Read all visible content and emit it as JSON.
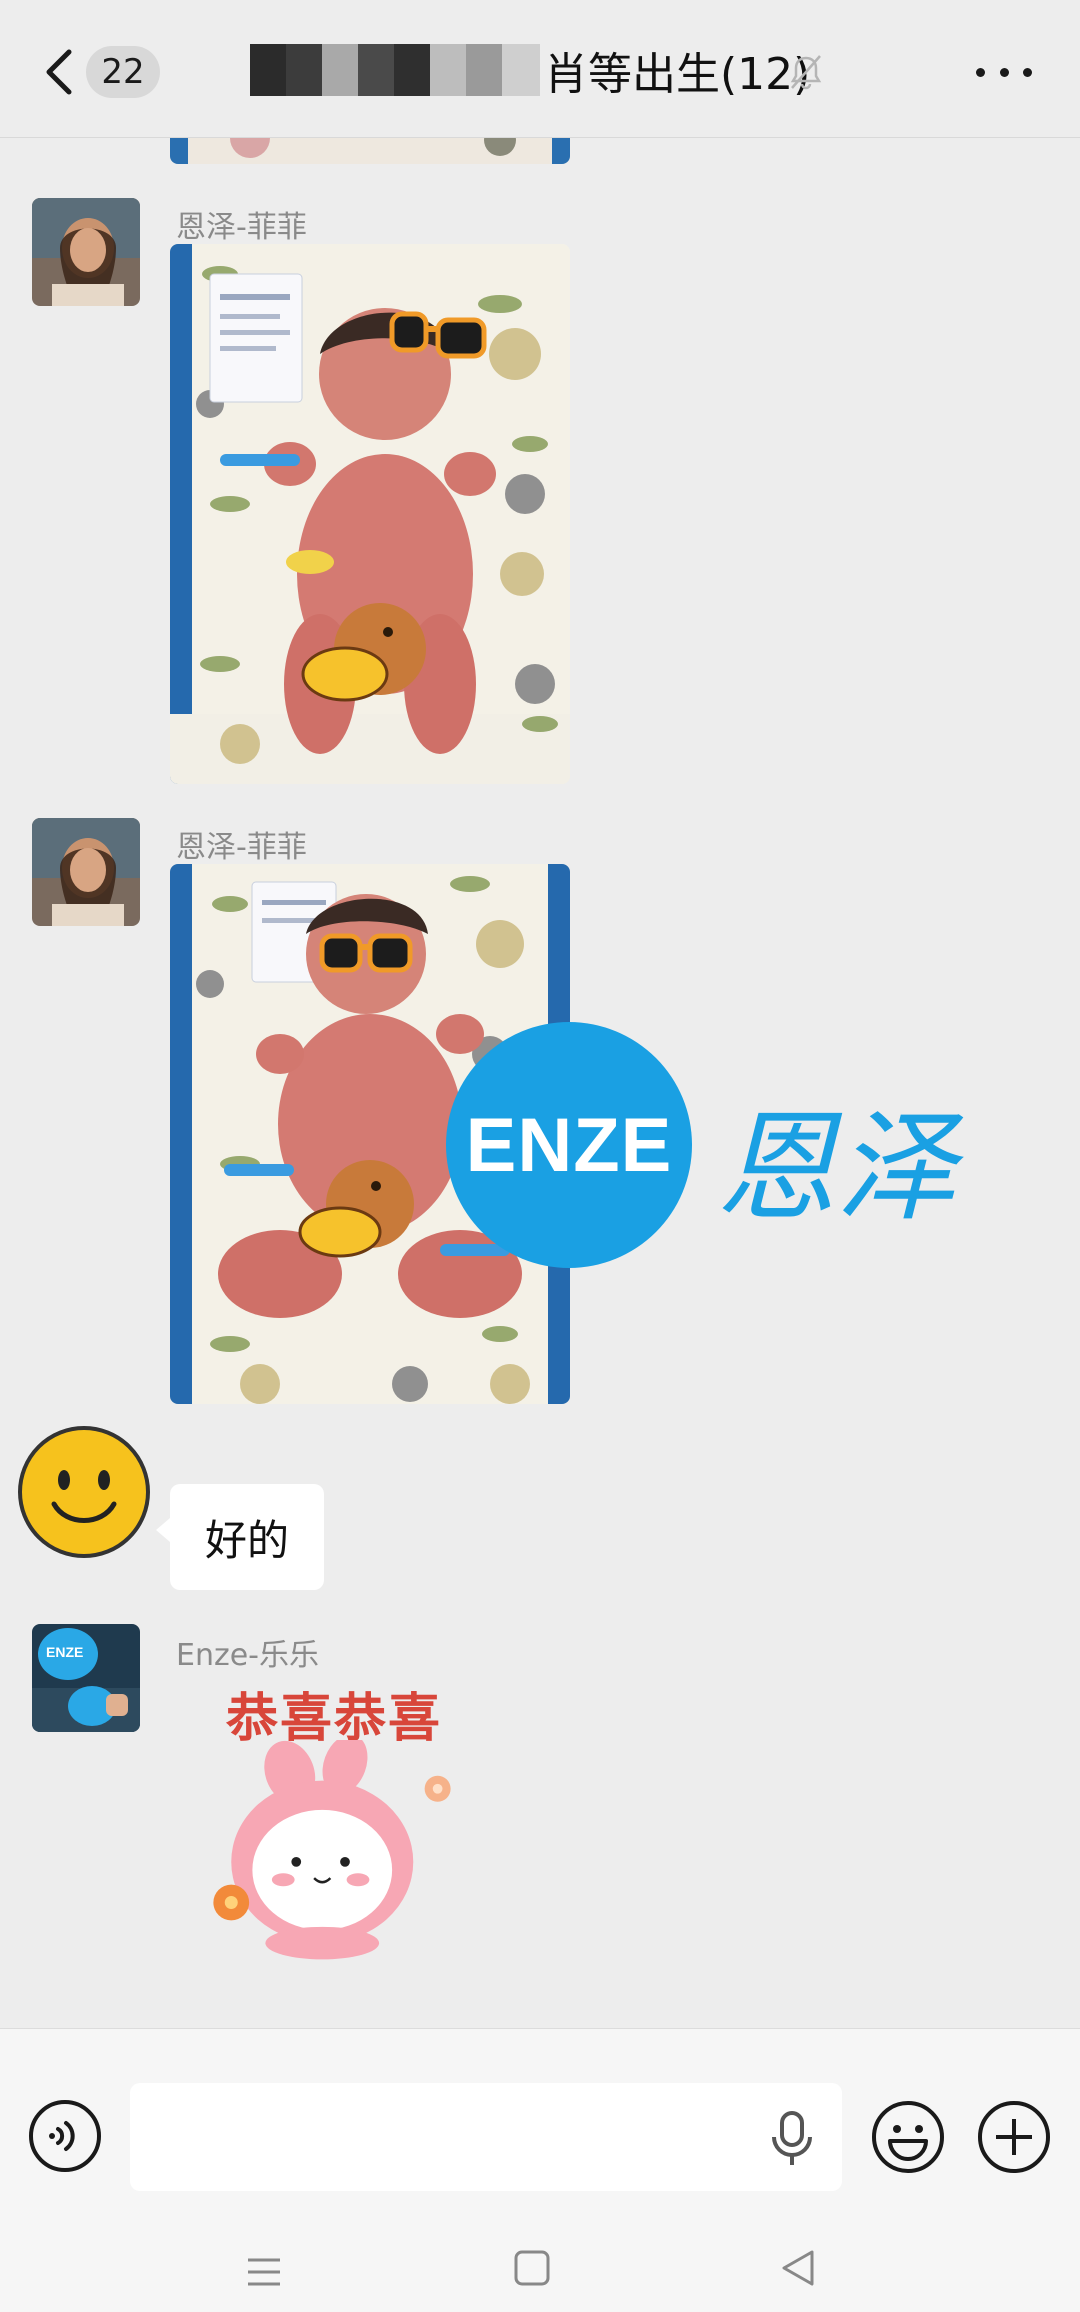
{
  "header": {
    "unread_count": "22",
    "title": "肖等出生(12)",
    "back_icon": "chevron-left-icon",
    "mute_icon": "bell-off-icon",
    "more_icon": "more-dots-icon"
  },
  "messages": [
    {
      "sender": "恩泽-菲菲",
      "type": "image",
      "content": "newborn-photo-1"
    },
    {
      "sender": "恩泽-菲菲",
      "type": "image",
      "content": "newborn-photo-2"
    },
    {
      "type": "text",
      "text": "好的"
    },
    {
      "sender": "Enze-乐乐",
      "type": "sticker",
      "sticker_text": "恭喜恭喜"
    }
  ],
  "overlay": {
    "logo_circle_text": "ENZE",
    "logo_cn_text": "恩泽"
  },
  "input_bar": {
    "voice_icon": "voice-icon",
    "input_value": "",
    "mic_icon": "mic-icon",
    "emoji_icon": "emoji-icon",
    "plus_icon": "plus-icon"
  },
  "nav": {
    "menu_icon": "menu-icon",
    "home_icon": "home-icon",
    "back_icon": "back-triangle-icon"
  },
  "colors": {
    "brand_blue": "#1aa0e3",
    "background": "#ededed"
  }
}
